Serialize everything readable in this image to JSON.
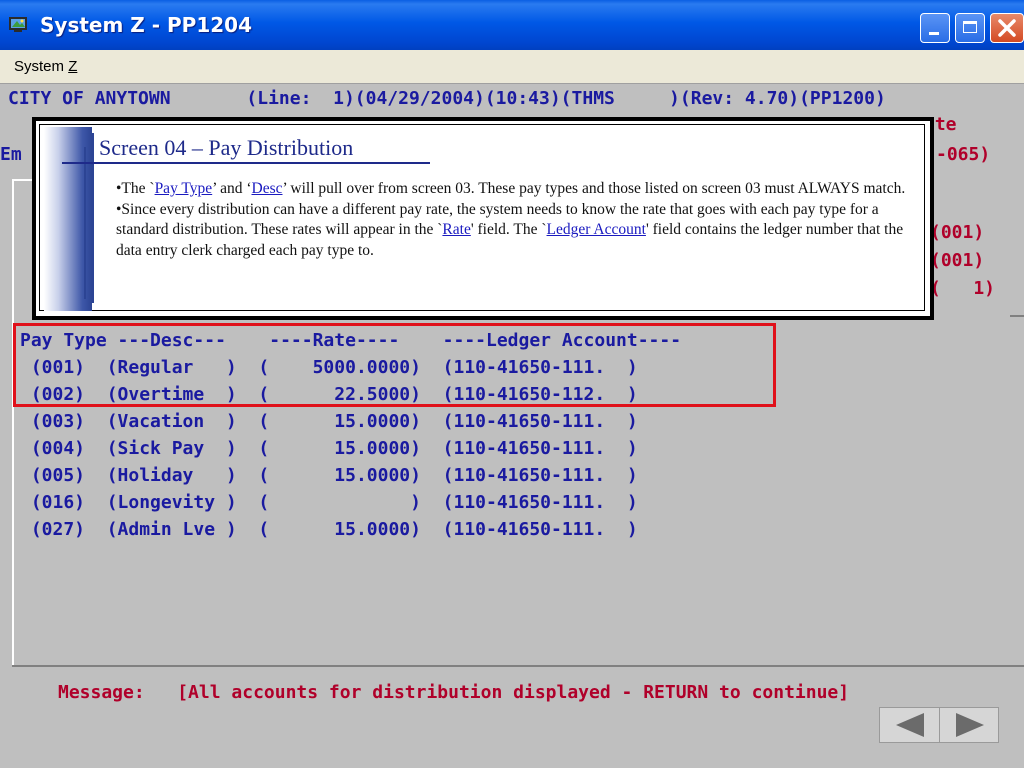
{
  "window": {
    "title": "System Z - PP1204"
  },
  "menu": {
    "items": [
      {
        "label": "System Z"
      }
    ]
  },
  "terminal": {
    "header": "CITY OF ANYTOWN       (Line:  1)(04/29/2004)(10:43)(THMS     )(Rev: 4.70)(PP1200)",
    "fragments": {
      "ate": "ate",
      "em": "Em",
      "code_065": "-065)",
      "r001a": "(001)",
      "r001b": "(001)",
      "r1": "(   1)"
    },
    "columns_header": "Pay Type ---Desc---    ----Rate----    ----Ledger Account----",
    "rows": [
      " (001)  (Regular   )  (    5000.0000)  (110-41650-111.  )",
      " (002)  (Overtime  )  (      22.5000)  (110-41650-112.  )",
      " (003)  (Vacation  )  (      15.0000)  (110-41650-111.  )",
      " (004)  (Sick Pay  )  (      15.0000)  (110-41650-111.  )",
      " (005)  (Holiday   )  (      15.0000)  (110-41650-111.  )",
      " (016)  (Longevity )  (             )  (110-41650-111.  )",
      " (027)  (Admin Lve )  (      15.0000)  (110-41650-111.  )"
    ],
    "message": "Message:   [All accounts for distribution displayed - RETURN to continue]"
  },
  "callout": {
    "title": "Screen 04 – Pay Distribution",
    "b1_pre": "•The `",
    "b1_link1": "Pay Type",
    "b1_mid": "’ and ‘",
    "b1_link2": "Desc",
    "b1_post": "’ will pull over from screen 03.  These pay types and those listed on screen 03 must ALWAYS match.",
    "b2_pre": "•Since every distribution can have a different pay rate, the system needs to know the rate that goes with each pay type for a standard distribution. These rates will appear in the `",
    "b2_link1": "Rate",
    "b2_mid": "' field.  The `",
    "b2_link2": "Ledger Account",
    "b2_post": "' field contains the ledger number that the data entry clerk charged each pay type to."
  },
  "colors": {
    "titlebar": "#0058e6",
    "terminal_bg": "#bfbfbf",
    "terminal_text": "#1a1aa0",
    "message_text": "#b0002a",
    "highlight": "#e0101a"
  },
  "icons": {
    "app": "app-icon",
    "minimize": "minimize-icon",
    "maximize": "maximize-icon",
    "close": "close-icon",
    "prev": "prev-arrow-icon",
    "next": "next-arrow-icon"
  }
}
